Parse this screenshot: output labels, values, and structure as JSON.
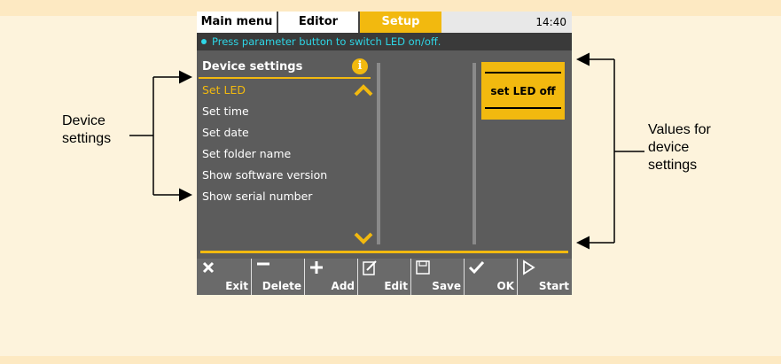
{
  "tabs": {
    "main_menu": "Main menu",
    "editor": "Editor",
    "setup": "Setup"
  },
  "clock": "14:40",
  "hint": "Press parameter button to switch LED on/off.",
  "list": {
    "header": "Device settings",
    "items": [
      "Set LED",
      "Set time",
      "Set date",
      "Set folder name",
      "Show software version",
      "Show serial number"
    ],
    "selected": "Set LED"
  },
  "value_box": {
    "label": "set LED off"
  },
  "buttons": [
    {
      "label": "Exit",
      "icon": "x-icon"
    },
    {
      "label": "Delete",
      "icon": "minus-icon"
    },
    {
      "label": "Add",
      "icon": "plus-icon"
    },
    {
      "label": "Edit",
      "icon": "edit-icon"
    },
    {
      "label": "Save",
      "icon": "save-icon"
    },
    {
      "label": "OK",
      "icon": "check-icon"
    },
    {
      "label": "Start",
      "icon": "play-icon"
    }
  ],
  "annotations": {
    "left": [
      "Device",
      "settings"
    ],
    "right": [
      "Values for",
      "device",
      "settings"
    ]
  },
  "colors": {
    "accent": "#f2b90f",
    "hint": "#2ed6e6",
    "screen_bg": "#5c5c5c"
  }
}
